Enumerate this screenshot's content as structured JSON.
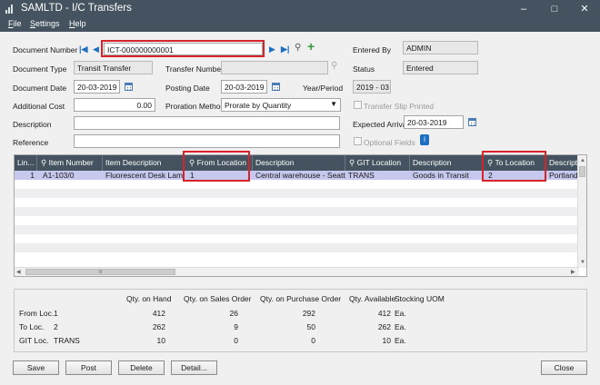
{
  "window": {
    "title": "SAMLTD - I/C Transfers",
    "minimize": "–",
    "maximize": "□",
    "close": "✕"
  },
  "menu": {
    "file": "File",
    "settings": "Settings",
    "help": "Help"
  },
  "form": {
    "document_number_label": "Document Number",
    "document_number": "ICT-000000000001",
    "entered_by_label": "Entered By",
    "entered_by": "ADMIN",
    "document_type_label": "Document Type",
    "document_type": "Transit Transfer",
    "transfer_number_label": "Transfer Number",
    "transfer_number": "",
    "status_label": "Status",
    "status": "Entered",
    "document_date_label": "Document Date",
    "document_date": "20-03-2019",
    "posting_date_label": "Posting Date",
    "posting_date": "20-03-2019",
    "year_period_label": "Year/Period",
    "year_period": "2019 - 03",
    "additional_cost_label": "Additional Cost",
    "additional_cost": "0.00",
    "proration_method_label": "Proration Method",
    "proration_method": "Prorate by Quantity",
    "transfer_slip_printed_label": "Transfer Slip Printed",
    "description_label": "Description",
    "description": "",
    "expected_arrival_label": "Expected Arrival",
    "expected_arrival": "20-03-2019",
    "reference_label": "Reference",
    "reference": "",
    "optional_fields_label": "Optional Fields"
  },
  "grid": {
    "columns": [
      "Lin...",
      "Item Number",
      "Item Description",
      "From Location",
      "Description",
      "GIT Location",
      "Description",
      "To Location",
      "Descripti"
    ],
    "rows": [
      {
        "line": "1",
        "item_number": "A1-103/0",
        "item_description": "Fluorescent Desk Lamp",
        "from_location": "1",
        "from_description": "Central warehouse - Seattle",
        "git_location": "TRANS",
        "git_description": "Goods in Transit",
        "to_location": "2",
        "to_description": "Portland O"
      }
    ],
    "hscroll_marker": "III"
  },
  "quantities": {
    "headers": [
      "Qty. on Hand",
      "Qty. on Sales Order",
      "Qty. on Purchase Order",
      "Qty. Available",
      "Stocking UOM"
    ],
    "rows": [
      {
        "label": "From Loc.",
        "location": "1",
        "on_hand": "412",
        "on_sales_order": "26",
        "on_purchase_order": "292",
        "available": "412",
        "uom": "Ea."
      },
      {
        "label": "To Loc.",
        "location": "2",
        "on_hand": "262",
        "on_sales_order": "9",
        "on_purchase_order": "50",
        "available": "262",
        "uom": "Ea."
      },
      {
        "label": "GIT Loc.",
        "location": "TRANS",
        "on_hand": "10",
        "on_sales_order": "0",
        "on_purchase_order": "0",
        "available": "10",
        "uom": "Ea."
      }
    ]
  },
  "buttons": {
    "save": "Save",
    "post": "Post",
    "delete": "Delete",
    "detail": "Detail...",
    "close": "Close"
  },
  "colors": {
    "titlebar": "#44535f",
    "highlight_box": "#d8232a",
    "selected_row": "#c7c8ee",
    "nav_arrow": "#1f6fc0",
    "add_icon": "#2e9e3b"
  },
  "icons": [
    "app-icon",
    "first-record-icon",
    "previous-record-icon",
    "next-record-icon",
    "last-record-icon",
    "search-icon",
    "add-icon",
    "calendar-icon",
    "dropdown-icon",
    "info-icon"
  ]
}
